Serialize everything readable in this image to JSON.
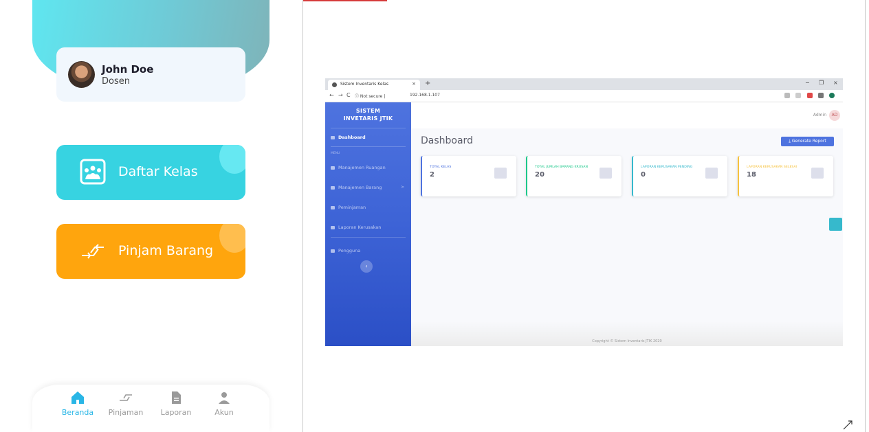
{
  "mobile": {
    "profile": {
      "name": "John Doe",
      "role": "Dosen"
    },
    "menu": [
      {
        "label": "Daftar Kelas",
        "icon": "classroom-icon",
        "color": "#37d3e1"
      },
      {
        "label": "Pinjam Barang",
        "icon": "swap-arrows-icon",
        "color": "#ffa50d"
      }
    ],
    "nav": [
      {
        "label": "Beranda",
        "icon": "home-icon",
        "active": true
      },
      {
        "label": "Pinjaman",
        "icon": "swap-arrows-icon",
        "active": false
      },
      {
        "label": "Laporan",
        "icon": "document-icon",
        "active": false
      },
      {
        "label": "Akun",
        "icon": "user-icon",
        "active": false
      }
    ],
    "colors": {
      "accent": "#29b6e6"
    }
  },
  "browser": {
    "tab_title": "Sistem Inventaris Kelas",
    "tab_close": "×",
    "new_tab": "+",
    "window_controls": {
      "minimize": "−",
      "maximize": "❐",
      "close": "×"
    },
    "url_security": "Not secure",
    "url": "192.168.1.107",
    "app": {
      "brand_line1": "SISTEM",
      "brand_line2": "INVETARIS JTIK",
      "sidebar_heading": "MENU",
      "sidebar": [
        {
          "label": "Dashboard",
          "active": true
        },
        {
          "label": "Manajemen Ruangan",
          "active": false
        },
        {
          "label": "Manajemen Barang",
          "active": false
        },
        {
          "label": "Peminjaman",
          "active": false
        },
        {
          "label": "Laporan Kerusakan",
          "active": false
        },
        {
          "label": "Pengguna",
          "active": false
        }
      ],
      "sidebar_caret": ">",
      "sidebar_toggle": "‹",
      "admin_name": "Admin",
      "admin_initials": "AD",
      "page_title": "Dashboard",
      "generate_report": "⤓ Generate Report",
      "cards": [
        {
          "label": "TOTAL KELAS",
          "value": "2",
          "color": "#4e73df"
        },
        {
          "label": "TOTAL JUMLAH BARANG KRUSAN",
          "value": "20",
          "color": "#1cc88a"
        },
        {
          "label": "LAPORAN KERUSAKAN PENDING",
          "value": "0",
          "color": "#36b9cc"
        },
        {
          "label": "LAPORAN KERUSAKAN SELESAI",
          "value": "18",
          "color": "#f6c23e"
        }
      ],
      "footer": "Copyright © Sistem Inventaris JTIK 2020"
    }
  }
}
